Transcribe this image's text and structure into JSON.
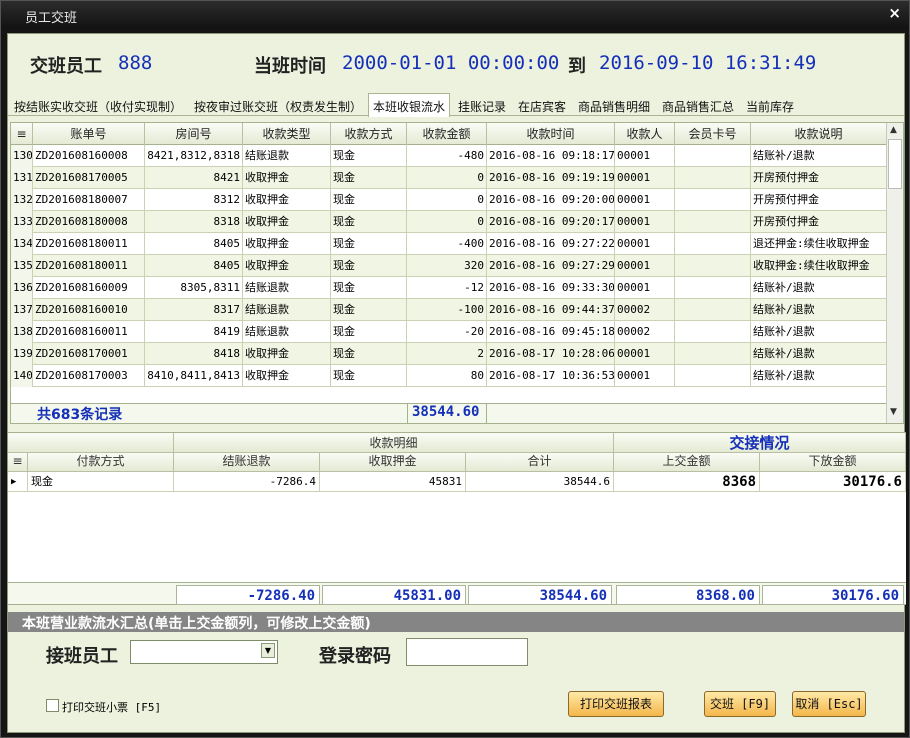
{
  "window": {
    "title": "员工交班",
    "close_glyph": "×"
  },
  "header": {
    "staff_label": "交班员工",
    "staff_value": "888",
    "time_label": "当班时间",
    "time_from": "2000-01-01 00:00:00",
    "to_label": "到",
    "time_to": "2016-09-10 16:31:49"
  },
  "tabs": [
    {
      "label": "按结账实收交班（收付实现制）"
    },
    {
      "label": "按夜审过账交班（权责发生制）"
    },
    {
      "label": "本班收银流水"
    },
    {
      "label": "挂账记录"
    },
    {
      "label": "在店宾客"
    },
    {
      "label": "商品销售明细"
    },
    {
      "label": "商品销售汇总"
    },
    {
      "label": "当前库存"
    }
  ],
  "flow_table": {
    "columns": [
      "账单号",
      "房间号",
      "收款类型",
      "收款方式",
      "收款金额",
      "收款时间",
      "收款人",
      "会员卡号",
      "收款说明"
    ],
    "rows": [
      {
        "n": "130",
        "cells": [
          "ZD201608160008",
          "8421,8312,8318",
          "结账退款",
          "现金",
          "-480",
          "2016-08-16 09:18:17",
          "00001",
          "",
          "结账补/退款"
        ]
      },
      {
        "n": "131",
        "cells": [
          "ZD201608170005",
          "8421",
          "收取押金",
          "现金",
          "0",
          "2016-08-16 09:19:19",
          "00001",
          "",
          "开房预付押金"
        ]
      },
      {
        "n": "132",
        "cells": [
          "ZD201608180007",
          "8312",
          "收取押金",
          "现金",
          "0",
          "2016-08-16 09:20:00",
          "00001",
          "",
          "开房预付押金"
        ]
      },
      {
        "n": "133",
        "cells": [
          "ZD201608180008",
          "8318",
          "收取押金",
          "现金",
          "0",
          "2016-08-16 09:20:17",
          "00001",
          "",
          "开房预付押金"
        ]
      },
      {
        "n": "134",
        "cells": [
          "ZD201608180011",
          "8405",
          "收取押金",
          "现金",
          "-400",
          "2016-08-16 09:27:22",
          "00001",
          "",
          "退还押金:续住收取押金"
        ]
      },
      {
        "n": "135",
        "cells": [
          "ZD201608180011",
          "8405",
          "收取押金",
          "现金",
          "320",
          "2016-08-16 09:27:29",
          "00001",
          "",
          "收取押金:续住收取押金"
        ]
      },
      {
        "n": "136",
        "cells": [
          "ZD201608160009",
          "8305,8311",
          "结账退款",
          "现金",
          "-12",
          "2016-08-16 09:33:30",
          "00001",
          "",
          "结账补/退款"
        ]
      },
      {
        "n": "137",
        "cells": [
          "ZD201608160010",
          "8317",
          "结账退款",
          "现金",
          "-100",
          "2016-08-16 09:44:37",
          "00002",
          "",
          "结账补/退款"
        ]
      },
      {
        "n": "138",
        "cells": [
          "ZD201608160011",
          "8419",
          "结账退款",
          "现金",
          "-20",
          "2016-08-16 09:45:18",
          "00002",
          "",
          "结账补/退款"
        ]
      },
      {
        "n": "139",
        "cells": [
          "ZD201608170001",
          "8418",
          "收取押金",
          "现金",
          "2",
          "2016-08-17 10:28:06",
          "00001",
          "",
          "结账补/退款"
        ]
      },
      {
        "n": "140",
        "cells": [
          "ZD201608170003",
          "8410,8411,8413",
          "收取押金",
          "现金",
          "80",
          "2016-08-17 10:36:53",
          "00001",
          "",
          "结账补/退款"
        ]
      }
    ],
    "record_count": "共683条记录",
    "sum_amount": "38544.60"
  },
  "detail_table": {
    "group_label": "收款明细",
    "handover_label": "交接情况",
    "columns": [
      "付款方式",
      "结账退款",
      "收取押金",
      "合计",
      "上交金额",
      "下放金额"
    ],
    "row": [
      "现金",
      "-7286.4",
      "45831",
      "38544.6",
      "8368",
      "30176.6"
    ],
    "totals": [
      "-7286.40",
      "45831.00",
      "38544.60",
      "8368.00",
      "30176.60"
    ]
  },
  "summary_bar": "本班营业款流水汇总(单击上交金额列，可修改上交金额)",
  "form": {
    "receiver_label": "接班员工",
    "password_label": "登录密码"
  },
  "footer": {
    "print_ticket_label": "打印交班小票 [F5]",
    "print_report_button": "打印交班报表",
    "handover_button": "交班 [F9]",
    "cancel_button": "取消 [Esc]"
  }
}
